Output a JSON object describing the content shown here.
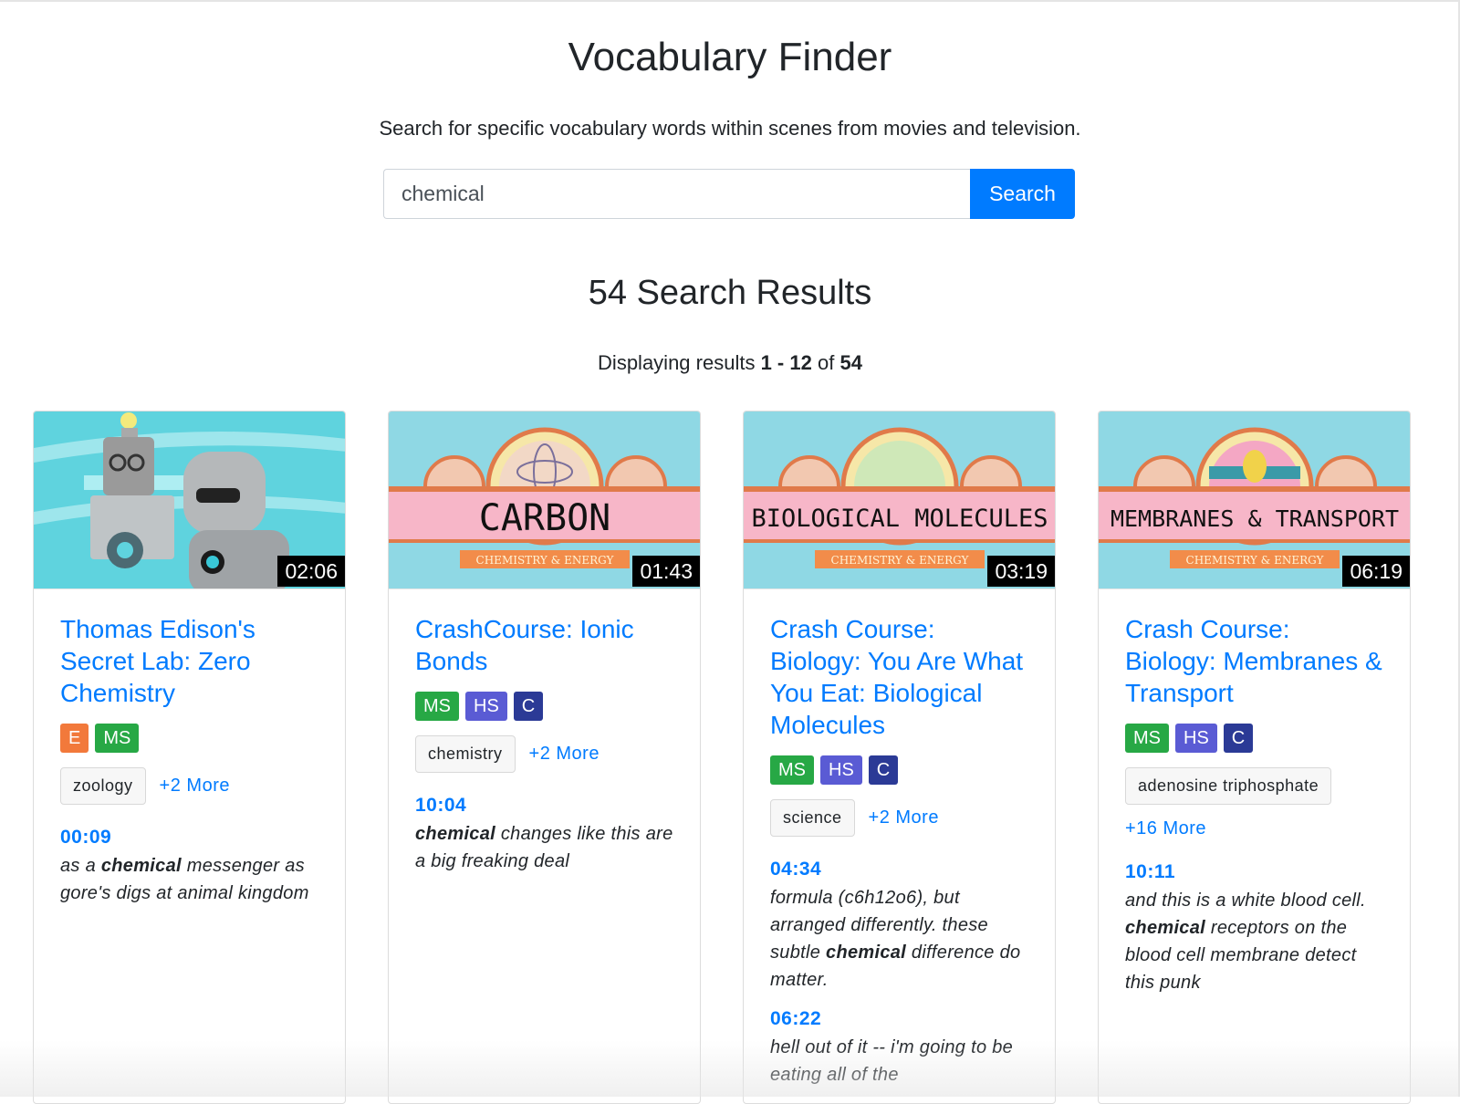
{
  "header": {
    "title": "Vocabulary Finder",
    "subtitle": "Search for specific vocabulary words within scenes from movies and television."
  },
  "search": {
    "value": "chemical",
    "button_label": "Search"
  },
  "results": {
    "heading": "54 Search Results",
    "info_prefix": "Displaying results",
    "range": "1 - 12",
    "info_of": "of",
    "total": "54"
  },
  "colors": {
    "link": "#007bff",
    "E": "#f2793b",
    "MS": "#27a845",
    "HS": "#5a5bd4",
    "C": "#2b3a96"
  },
  "cards": [
    {
      "duration": "02:06",
      "title": "Thomas Edison's Secret Lab: Zero Chemistry",
      "badges": [
        "E",
        "MS"
      ],
      "tags": [
        "zoology"
      ],
      "more": "+2 More",
      "snippets": [
        {
          "time": "00:09",
          "before": "as a ",
          "word": "chemical",
          "after": " messenger as gore's digs at animal kingdom"
        }
      ]
    },
    {
      "duration": "01:43",
      "thumb_text": "CARBON",
      "thumb_sub": "CHEMISTRY & ENERGY",
      "title": "CrashCourse: Ionic Bonds",
      "badges": [
        "MS",
        "HS",
        "C"
      ],
      "tags": [
        "chemistry"
      ],
      "more": "+2 More",
      "snippets": [
        {
          "time": "10:04",
          "before": "",
          "word": "chemical",
          "after": " changes like this are a big freaking deal"
        }
      ]
    },
    {
      "duration": "03:19",
      "thumb_text": "BIOLOGICAL MOLECULES",
      "thumb_sub": "CHEMISTRY & ENERGY",
      "title": "Crash Course: Biology: You Are What You Eat: Biological Molecules",
      "badges": [
        "MS",
        "HS",
        "C"
      ],
      "tags": [
        "science"
      ],
      "more": "+2 More",
      "snippets": [
        {
          "time": "04:34",
          "before": "formula (c6h12o6), but arranged differently. these subtle ",
          "word": "chemical",
          "after": " difference do matter."
        },
        {
          "time": "06:22",
          "before": "hell out of it -- i'm going to be eating all of the",
          "word": "",
          "after": ""
        }
      ]
    },
    {
      "duration": "06:19",
      "thumb_text": "MEMBRANES & TRANSPORT",
      "thumb_sub": "CHEMISTRY & ENERGY",
      "title": "Crash Course: Biology: Membranes & Transport",
      "badges": [
        "MS",
        "HS",
        "C"
      ],
      "tags": [
        "adenosine triphosphate"
      ],
      "more": "+16 More",
      "snippets": [
        {
          "time": "10:11",
          "before": "and this is a white blood cell. ",
          "word": "chemical",
          "after": " receptors on the blood cell membrane detect this punk"
        }
      ]
    }
  ]
}
